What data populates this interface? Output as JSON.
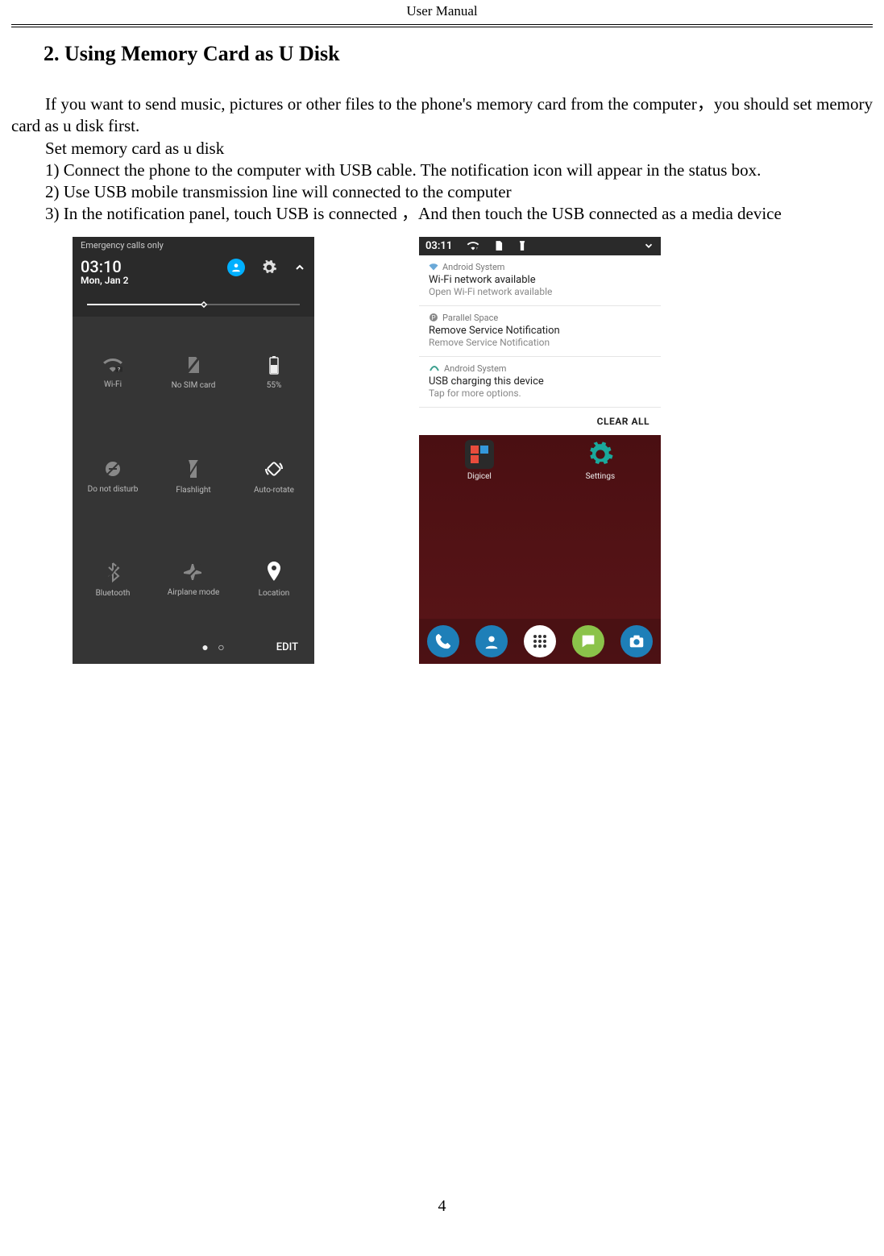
{
  "header": {
    "title": "User    Manual"
  },
  "section": {
    "heading": "2. Using Memory Card as U Disk"
  },
  "paragraphs": {
    "p1": "If you want to send music, pictures or other files to the phone's memory card from the computer，you should set memory card as u disk first.",
    "p2": "Set memory card as u disk",
    "p3": "1) Connect the phone to the computer with USB cable. The notification icon will appear in the status box.",
    "p4": "2) Use USB mobile transmission line will connected to the computer",
    "p5": "3) In the notification panel, touch USB is connected ，And then touch the USB connected as a media device"
  },
  "shot1": {
    "status": "Emergency calls only",
    "clock": "03:10",
    "date": "Mon, Jan 2",
    "tiles": [
      {
        "label": "Wi-Fi"
      },
      {
        "label": "No SIM card"
      },
      {
        "label": "55%"
      },
      {
        "label": "Do not disturb"
      },
      {
        "label": "Flashlight"
      },
      {
        "label": "Auto-rotate"
      },
      {
        "label": "Bluetooth"
      },
      {
        "label": "Airplane mode"
      },
      {
        "label": "Location"
      }
    ],
    "edit": "EDIT"
  },
  "shot2": {
    "clock": "03:11",
    "cards": [
      {
        "source": "Android System",
        "title": "Wi-Fi network available",
        "sub": "Open Wi-Fi network available"
      },
      {
        "source": "Parallel Space",
        "title": "Remove Service Notification",
        "sub": "Remove Service Notification"
      },
      {
        "source": "Android System",
        "title": "USB charging this device",
        "sub": "Tap for more options."
      }
    ],
    "clear": "CLEAR ALL",
    "apps": [
      {
        "label": "Digicel"
      },
      {
        "label": "Settings"
      }
    ]
  },
  "page_number": "4"
}
